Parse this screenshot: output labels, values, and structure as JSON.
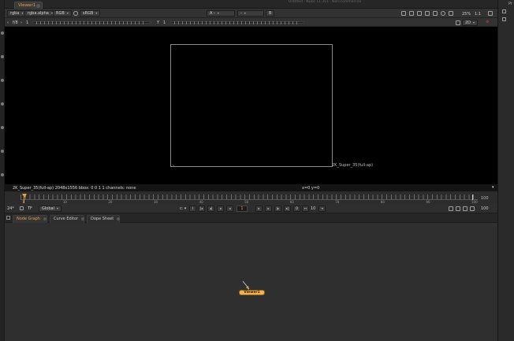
{
  "tab": {
    "label": "Viewer1"
  },
  "window_title": "Untitled - Nuke 11.3v1 - Non-commercial",
  "right_panel": {
    "label": "Pr"
  },
  "toolbar1": {
    "channels": "rgba",
    "alpha_channel": "rgba.alpha",
    "display_channels": "RGB",
    "lut": "sRGB",
    "input_a_label": "A",
    "input_a_value": "-",
    "input_b_value": "-",
    "input_b_label": "B",
    "zoom": "25%",
    "ratio": "1:1"
  },
  "toolbar2": {
    "fstop": "f/8",
    "gain_value": "1",
    "gamma_label": "Y",
    "gamma_value": "1",
    "mode": "2D"
  },
  "viewer": {
    "format_label": "2K_Super_35(full-ap)",
    "info_text": "2K_Super_35(full-ap) 2048x1556  bbox: 0 0 1 1 channels: none",
    "coords": "x=0 y=0"
  },
  "timeline": {
    "labels": [
      "1",
      "10",
      "20",
      "30",
      "40",
      "50",
      "60",
      "70",
      "80",
      "90",
      "100"
    ],
    "right_value": "100",
    "current_frame": 1
  },
  "transport": {
    "fps": "24*",
    "tf": "TF",
    "scope": "Global",
    "frame": "1",
    "increment": "10",
    "end_frame": "100"
  },
  "node_graph_tabs": [
    {
      "label": "Node Graph"
    },
    {
      "label": "Curve Editor"
    },
    {
      "label": "Dope Sheet"
    }
  ],
  "node": {
    "label": "Viewer1"
  },
  "colors": {
    "accent": "#e3a54a",
    "node": "#f0b34f",
    "viewer_bg": "#000000"
  }
}
